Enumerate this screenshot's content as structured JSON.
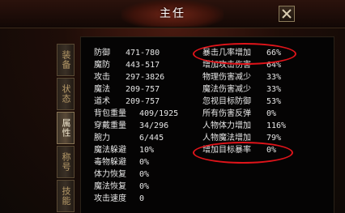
{
  "window": {
    "title": "主任",
    "close_label": "✕"
  },
  "tabs": [
    {
      "label": "装备",
      "active": false
    },
    {
      "label": "状态",
      "active": false
    },
    {
      "label": "属性",
      "active": true
    },
    {
      "label": "称号",
      "active": false
    },
    {
      "label": "技能",
      "active": false
    }
  ],
  "left_stats": [
    {
      "label": "防御",
      "value": "471-780"
    },
    {
      "label": "魔防",
      "value": "443-517"
    },
    {
      "label": "攻击",
      "value": "297-3826"
    },
    {
      "label": "魔法",
      "value": "209-757"
    },
    {
      "label": "道术",
      "value": "209-757"
    },
    {
      "label": "背包重量",
      "value": "409/1925"
    },
    {
      "label": "穿戴重量",
      "value": "34/296"
    },
    {
      "label": "腕力",
      "value": "6/445"
    },
    {
      "label": "魔法躲避",
      "value": "10%"
    },
    {
      "label": "毒物躲避",
      "value": "0%"
    },
    {
      "label": "体力恢复",
      "value": "0%"
    },
    {
      "label": "魔法恢复",
      "value": "0%"
    },
    {
      "label": "攻击速度",
      "value": "0"
    }
  ],
  "right_stats": [
    {
      "label": "暴击几率增加",
      "value": "66%"
    },
    {
      "label": "增加攻击伤害",
      "value": "64%"
    },
    {
      "label": "物理伤害减少",
      "value": "33%"
    },
    {
      "label": "魔法伤害减少",
      "value": "33%"
    },
    {
      "label": "忽视目标防御",
      "value": "53%"
    },
    {
      "label": "所有伤害反弹",
      "value": "0%"
    },
    {
      "label": "人物体力增加",
      "value": "116%"
    },
    {
      "label": "人物魔法增加",
      "value": "79%"
    },
    {
      "label": "增加目标暴率",
      "value": "0%"
    }
  ],
  "colors": {
    "highlight_ring": "#e0141a",
    "text": "#e6e6e6",
    "panel_bg": "#050404"
  }
}
